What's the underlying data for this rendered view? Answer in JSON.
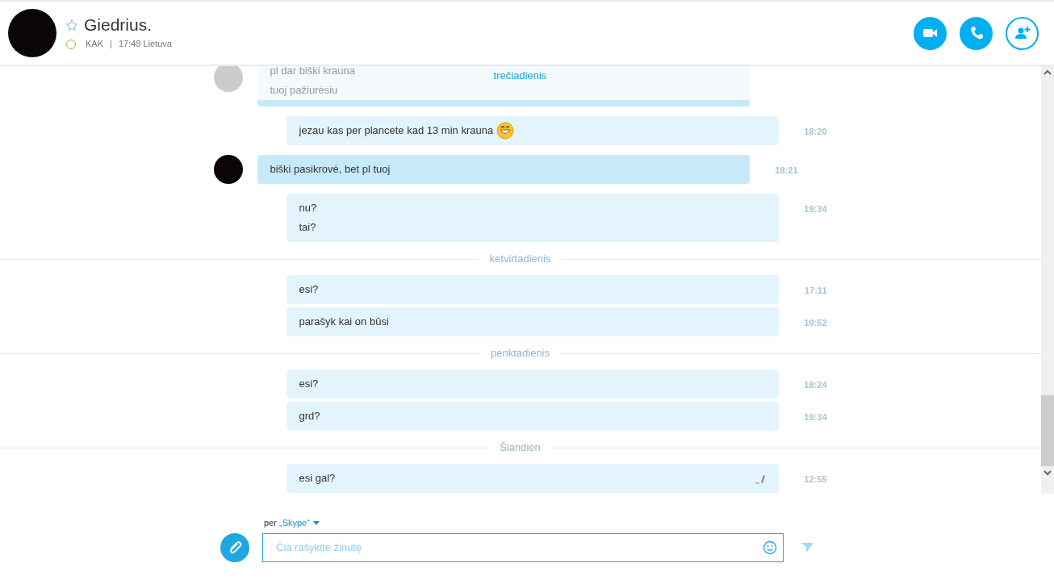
{
  "contact": {
    "name": "Giedrius.",
    "favorite": false,
    "presence": "KAK",
    "separator": "|",
    "local_time": "17:49 Lietuva"
  },
  "call_buttons": [
    {
      "kind": "video"
    },
    {
      "kind": "call"
    },
    {
      "kind": "add"
    }
  ],
  "messages": [
    {
      "kind": "faded",
      "lines": [
        "pl dar biški krauna",
        "tuoj pažiurėsiu"
      ],
      "overlay_day": "trečiadienis"
    },
    {
      "kind": "emoji",
      "lines": [
        "jezau kas per plancete kad 13 min krauna"
      ],
      "time": "18:20",
      "edited": false
    },
    {
      "kind": "received",
      "lines": [
        "biški pasikrovė, bet pl tuoj"
      ],
      "time": "18:21",
      "edited": false
    },
    {
      "kind": "sent",
      "lines": [
        "nu?",
        "tai?"
      ],
      "time": "19:34",
      "edited": false
    },
    {
      "kind": "day",
      "label": "ketvirtadienis"
    },
    {
      "kind": "sent",
      "lines": [
        "esi?"
      ],
      "time": "17:11",
      "edited": false
    },
    {
      "kind": "sent",
      "lines": [
        "parašyk kai on būsi"
      ],
      "time": "19:52",
      "edited": false
    },
    {
      "kind": "day",
      "label": "penktadienis"
    },
    {
      "kind": "sent",
      "lines": [
        "esi?"
      ],
      "time": "18:24",
      "edited": false
    },
    {
      "kind": "sent",
      "lines": [
        "grd?"
      ],
      "time": "19:34",
      "edited": false
    },
    {
      "kind": "day",
      "label": "Šiandien"
    },
    {
      "kind": "sent",
      "lines": [
        "esi gal?"
      ],
      "time": "12:55",
      "edited": true
    }
  ],
  "composer": {
    "via_prefix": "per",
    "via": "„Skype“",
    "placeholder": "Čia rašykite žinutę"
  }
}
